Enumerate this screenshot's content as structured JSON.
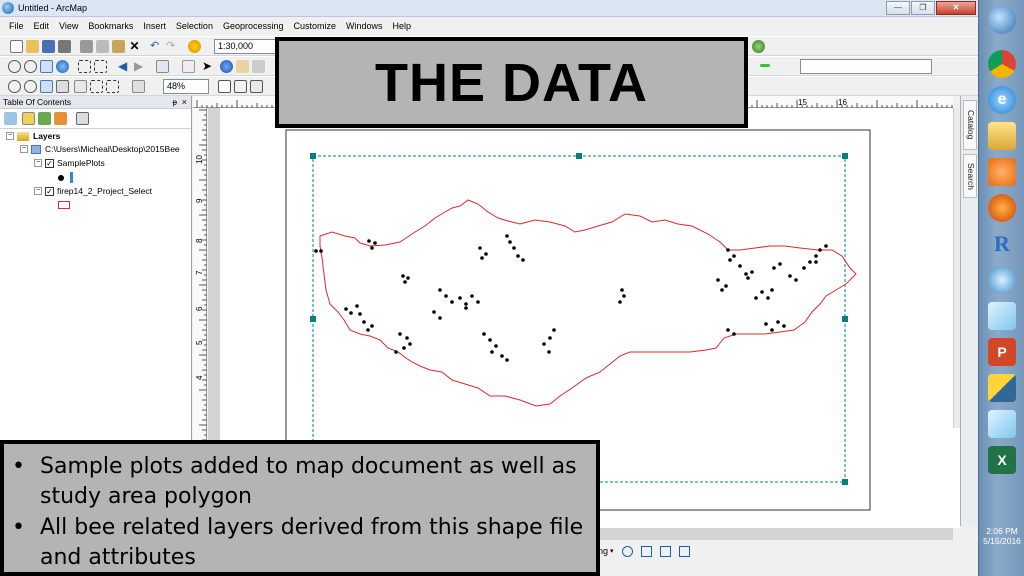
{
  "window": {
    "title": "Untitled - ArcMap",
    "min": "—",
    "max": "❐",
    "close": "✕"
  },
  "menu": [
    "File",
    "Edit",
    "View",
    "Bookmarks",
    "Insert",
    "Selection",
    "Geoprocessing",
    "Customize",
    "Windows",
    "Help"
  ],
  "toolbar": {
    "scale": "1:30,000",
    "zoom": "48%"
  },
  "toc": {
    "title": "Table Of Contents",
    "pin": "ᵽ",
    "close": "×",
    "root": "Layers",
    "path": "C:\\Users\\Micheal\\Desktop\\2015Bee",
    "layers": [
      {
        "name": "SamplePlots",
        "checked": true
      },
      {
        "name": "firep14_2_Project_Select",
        "checked": true
      }
    ]
  },
  "ruler": {
    "top_ticks": [
      "15",
      "16"
    ],
    "left_ticks": [
      "10",
      "9",
      "8",
      "7",
      "6",
      "5",
      "4"
    ]
  },
  "dock": {
    "catalog": "Catalog",
    "search": "Search"
  },
  "statusbar": {
    "text": "ng"
  },
  "tray": {
    "time": "2:06 PM",
    "date": "5/15/2016"
  },
  "slide": {
    "title": "THE DATA",
    "bullets": [
      "Sample plots added to map document as well as study area polygon",
      "All bee related layers derived from this shape file and attributes"
    ]
  },
  "colors": {
    "polygon": "#e0282c",
    "points": "#000000",
    "frame": "#008080",
    "overlay": "#b4b4b4"
  }
}
